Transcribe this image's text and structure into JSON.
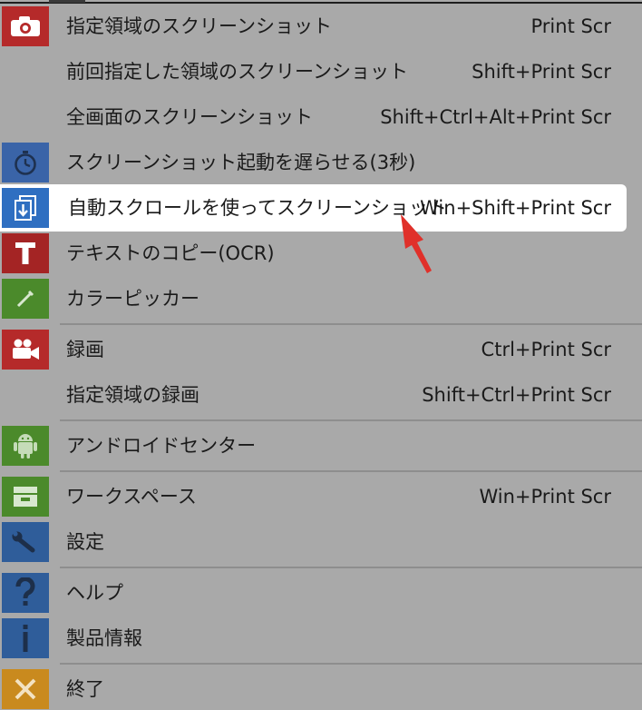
{
  "menu": {
    "items": [
      {
        "label": "指定領域のスクリーンショット",
        "shortcut": "Print Scr",
        "icon": "camera-icon",
        "icon_color": "#b52a2a"
      },
      {
        "label": "前回指定した領域のスクリーンショット",
        "shortcut": "Shift+Print Scr",
        "icon": "",
        "icon_color": ""
      },
      {
        "label": "全画面のスクリーンショット",
        "shortcut": "Shift+Ctrl+Alt+Print Scr",
        "icon": "",
        "icon_color": ""
      },
      {
        "label": "スクリーンショット起動を遅らせる(3秒)",
        "shortcut": "",
        "icon": "timer-icon",
        "icon_color": "#3a64a8"
      },
      {
        "label": "自動スクロールを使ってスクリーンショット",
        "shortcut": "Win+Shift+Print Scr",
        "icon": "scroll-capture-icon",
        "icon_color": "#2f6fc1",
        "highlighted": true
      },
      {
        "label": "テキストのコピー(OCR)",
        "shortcut": "",
        "icon": "text-t-icon",
        "icon_color": "#a42424"
      },
      {
        "label": "カラーピッカー",
        "shortcut": "",
        "icon": "eyedropper-icon",
        "icon_color": "#4b8a2b"
      },
      {
        "label": "録画",
        "shortcut": "Ctrl+Print Scr",
        "icon": "video-camera-icon",
        "icon_color": "#b52a2a"
      },
      {
        "label": "指定領域の録画",
        "shortcut": "Shift+Ctrl+Print Scr",
        "icon": "",
        "icon_color": ""
      },
      {
        "label": "アンドロイドセンター",
        "shortcut": "",
        "icon": "android-icon",
        "icon_color": "#4b8a2b"
      },
      {
        "label": "ワークスペース",
        "shortcut": "Win+Print Scr",
        "icon": "workspace-icon",
        "icon_color": "#4b8a2b"
      },
      {
        "label": "設定",
        "shortcut": "",
        "icon": "wrench-icon",
        "icon_color": "#2f5d9a"
      },
      {
        "label": "ヘルプ",
        "shortcut": "",
        "icon": "help-question-icon",
        "icon_color": "#2f5d9a"
      },
      {
        "label": "製品情報",
        "shortcut": "",
        "icon": "info-icon",
        "icon_color": "#2f5d9a"
      },
      {
        "label": "終了",
        "shortcut": "",
        "icon": "close-x-icon",
        "icon_color": "#c98a1e"
      }
    ]
  },
  "annotation": {
    "arrow_color": "#e0302a"
  }
}
